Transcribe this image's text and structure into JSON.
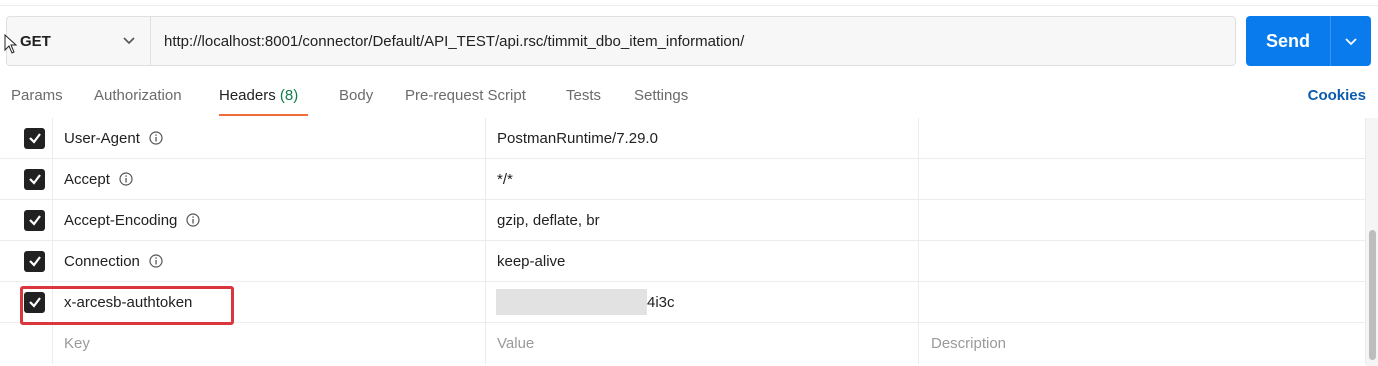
{
  "request": {
    "method": "GET",
    "url": "http://localhost:8001/connector/Default/API_TEST/api.rsc/timmit_dbo_item_information/",
    "send_label": "Send"
  },
  "tabs": [
    {
      "label": "Params"
    },
    {
      "label": "Authorization"
    },
    {
      "label": "Headers ",
      "count": "(8)",
      "active": true
    },
    {
      "label": "Body"
    },
    {
      "label": "Pre-request Script"
    },
    {
      "label": "Tests"
    },
    {
      "label": "Settings"
    }
  ],
  "cookies_label": "Cookies",
  "headers": [
    {
      "key": "User-Agent",
      "value": "PostmanRuntime/7.29.0",
      "checked": true,
      "info": true
    },
    {
      "key": "Accept",
      "value": "*/*",
      "checked": true,
      "info": true
    },
    {
      "key": "Accept-Encoding",
      "value": "gzip, deflate, br",
      "checked": true,
      "info": true
    },
    {
      "key": "Connection",
      "value": "keep-alive",
      "checked": true,
      "info": true
    },
    {
      "key": "x-arcesb-authtoken",
      "value_visible": "4i3c",
      "checked": true,
      "info": false,
      "redacted": true
    }
  ],
  "new_row": {
    "key_placeholder": "Key",
    "value_placeholder": "Value",
    "description_placeholder": "Description"
  },
  "colors": {
    "accent": "#097bed",
    "tab_underline": "#f26b3a",
    "highlight": "#d9363e",
    "count": "#0f7b4a",
    "cookies": "#0b5cad"
  }
}
